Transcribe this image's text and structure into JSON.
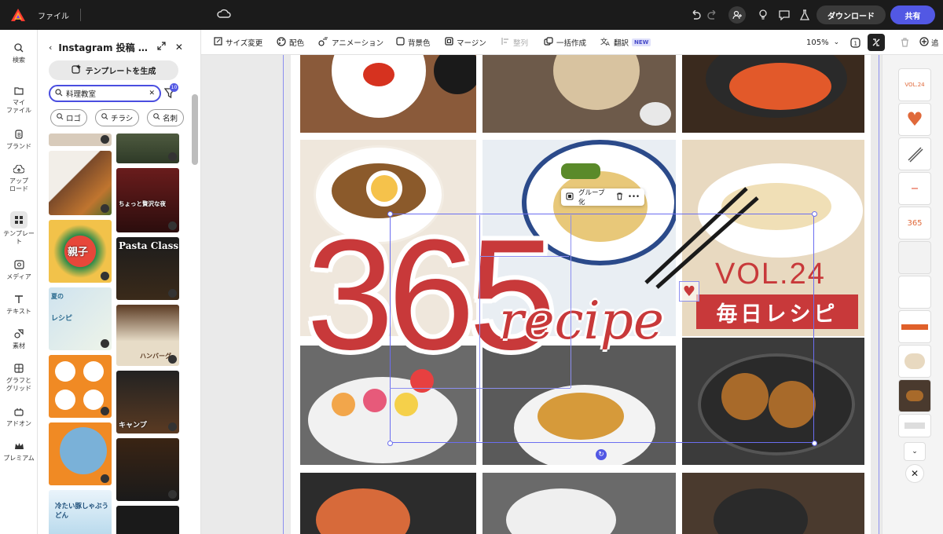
{
  "topbar": {
    "file_menu": "ファイル",
    "download": "ダウンロード",
    "share": "共有"
  },
  "rail": [
    {
      "label": "検索",
      "icon": "search-icon"
    },
    {
      "label": "マイ\nファイル",
      "icon": "folder-icon"
    },
    {
      "label": "ブランド",
      "icon": "brand-icon"
    },
    {
      "label": "アップ\nロード",
      "icon": "upload-icon"
    },
    {
      "label": "テンプレー\nト",
      "icon": "template-icon"
    },
    {
      "label": "メディア",
      "icon": "media-icon"
    },
    {
      "label": "テキスト",
      "icon": "text-icon"
    },
    {
      "label": "素材",
      "icon": "elements-icon"
    },
    {
      "label": "グラフと\nグリッド",
      "icon": "grid-icon"
    },
    {
      "label": "アドオン",
      "icon": "addon-icon"
    },
    {
      "label": "プレミアム",
      "icon": "crown-icon"
    }
  ],
  "panel": {
    "title": "Instagram 投稿 …",
    "generate": "テンプレートを生成",
    "search_value": "料理教室",
    "filter_count": "10",
    "chips": [
      "ロゴ",
      "チラシ",
      "名刺"
    ],
    "thumb_texts": [
      "ちょっと贅沢な夜",
      "Pasta Class",
      "親子",
      "夏の",
      "レシピ",
      "ハンバーグ",
      "キャンプ",
      "冷たい豚しゃぶうどん"
    ]
  },
  "toolbar": {
    "items": [
      {
        "label": "サイズ変更",
        "icon": "resize-icon"
      },
      {
        "label": "配色",
        "icon": "palette-icon"
      },
      {
        "label": "アニメーション",
        "icon": "animation-icon"
      },
      {
        "label": "背景色",
        "icon": "background-icon"
      },
      {
        "label": "マージン",
        "icon": "margin-icon"
      },
      {
        "label": "整列",
        "icon": "align-icon"
      },
      {
        "label": "一括作成",
        "icon": "bulk-create-icon"
      },
      {
        "label": "翻訳",
        "icon": "translate-icon"
      }
    ],
    "new_badge": "NEW",
    "zoom": "105%",
    "add_label": "追"
  },
  "canvas": {
    "big_number": "365",
    "script_word": "recipe",
    "volume": "VOL.24",
    "banner": "毎日レシピ",
    "group_label": "グループ化"
  },
  "pages": {
    "thumb_vol": "VOL.24",
    "thumb_365": "365"
  },
  "colors": {
    "accent": "#5258e4",
    "brand_red": "#c8393a",
    "topbar": "#1b1b1b"
  }
}
